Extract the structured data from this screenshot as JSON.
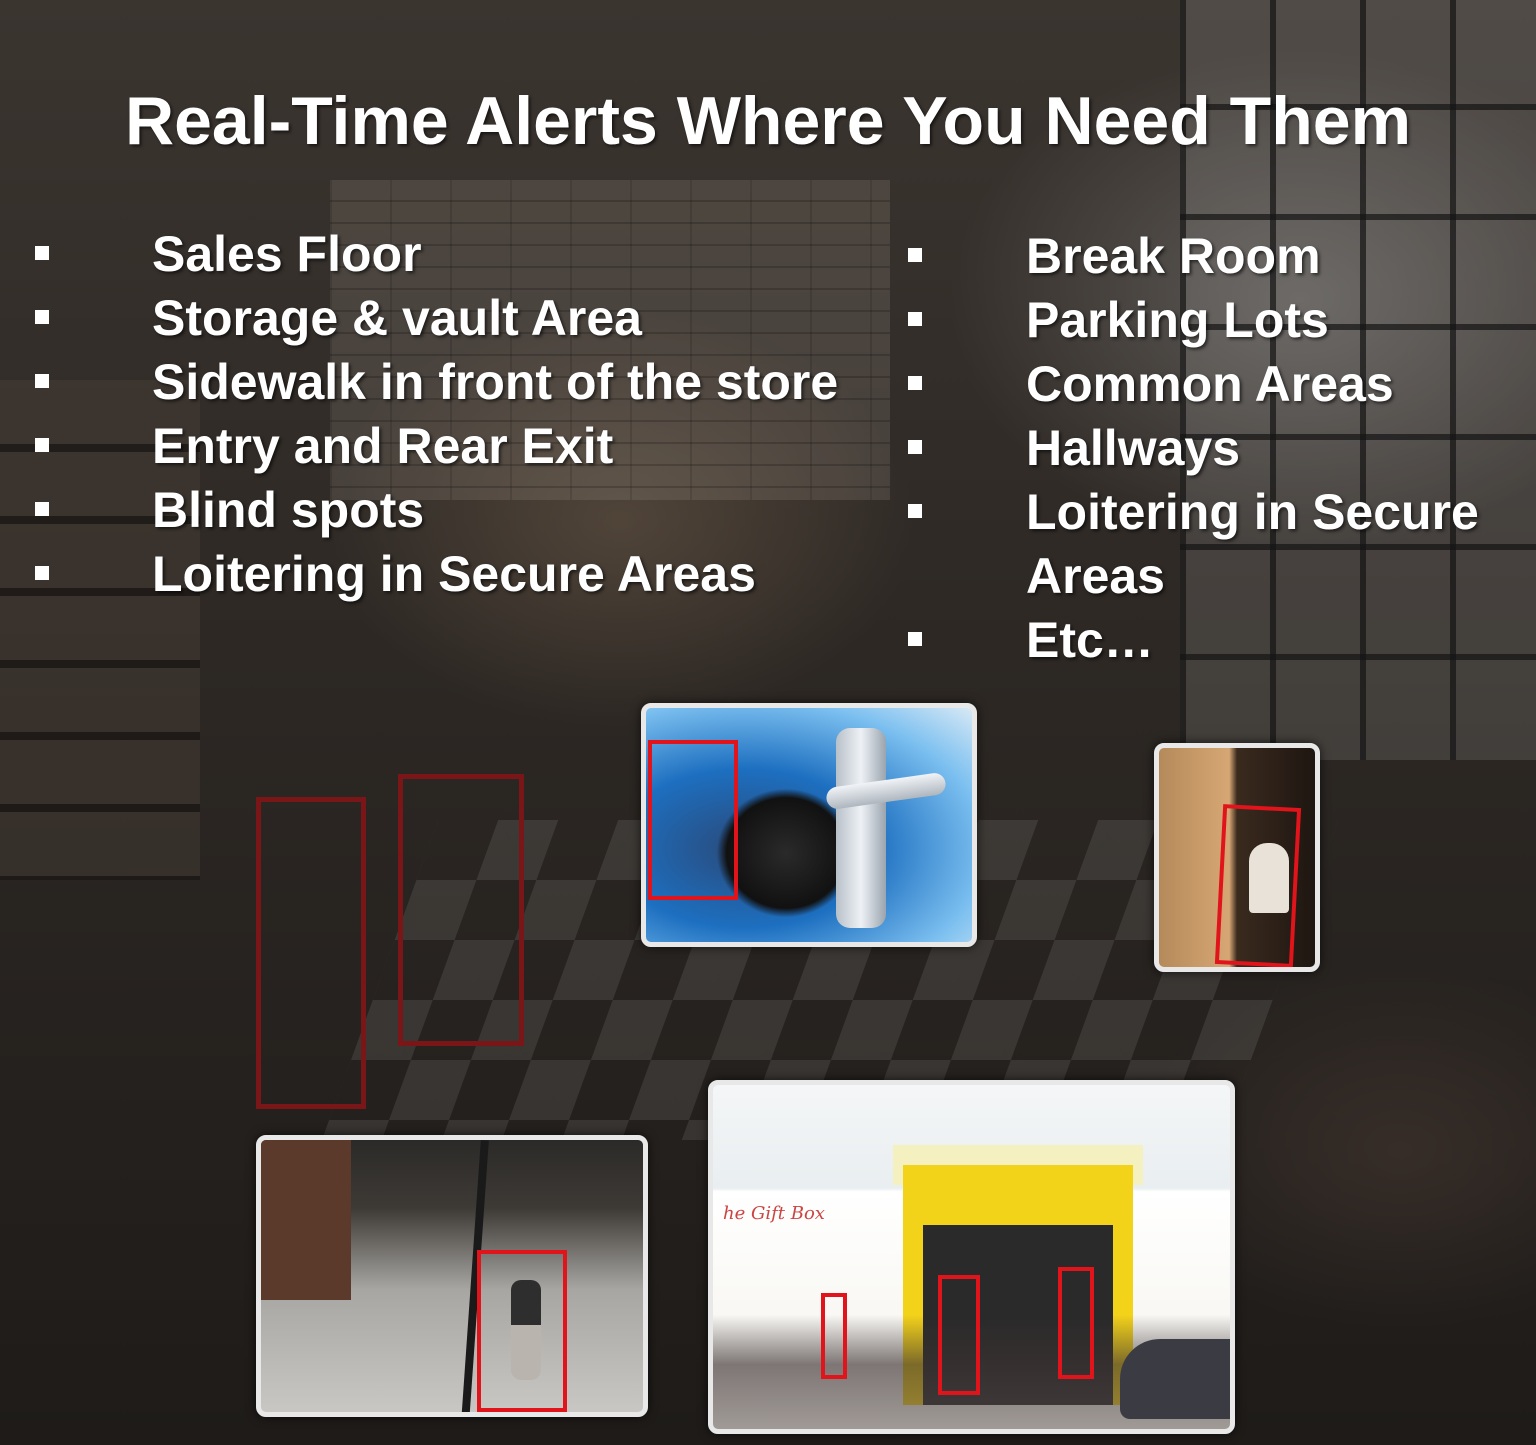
{
  "title": "Real-Time Alerts Where You Need Them",
  "left_list": [
    "Sales Floor",
    "Storage & vault Area",
    "Sidewalk in front of the store",
    "Entry and Rear Exit",
    "Blind spots",
    "Loitering in Secure Areas"
  ],
  "right_list": [
    "Break Room",
    "Parking Lots",
    "Common Areas",
    "Hallways",
    "Loitering in Secure",
    "Areas",
    "Etc…"
  ],
  "thumbnails": {
    "storefront_sign": "he Gift Box"
  },
  "colors": {
    "text": "#ffffff",
    "detection_red": "#e0141a",
    "detection_dark_red": "#7a1618"
  }
}
